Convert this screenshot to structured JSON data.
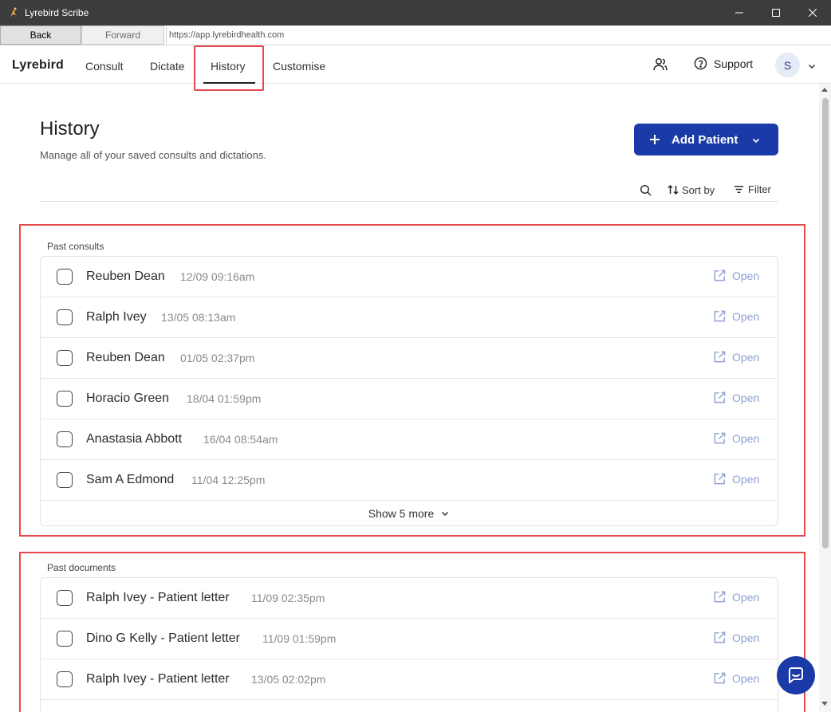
{
  "window": {
    "title": "Lyrebird Scribe",
    "back_label": "Back",
    "forward_label": "Forward",
    "url": "https://app.lyrebirdhealth.com"
  },
  "header": {
    "brand": "Lyrebird",
    "tabs": [
      "Consult",
      "Dictate",
      "History",
      "Customise"
    ],
    "active_tab": "History",
    "support_label": "Support",
    "avatar_initial": "S"
  },
  "page": {
    "title": "History",
    "subtitle": "Manage all of your saved consults and dictations.",
    "add_patient_label": "Add Patient",
    "sort_label": "Sort by",
    "filter_label": "Filter"
  },
  "past_consults": {
    "label": "Past consults",
    "rows": [
      {
        "name": "Reuben Dean",
        "time": "12/09 09:16am",
        "action": "Open"
      },
      {
        "name": "Ralph Ivey",
        "time": "13/05 08:13am",
        "action": "Open"
      },
      {
        "name": "Reuben Dean",
        "time": "01/05 02:37pm",
        "action": "Open"
      },
      {
        "name": "Horacio Green",
        "time": "18/04 01:59pm",
        "action": "Open"
      },
      {
        "name": "Anastasia Abbott",
        "time": "16/04 08:54am",
        "action": "Open"
      },
      {
        "name": "Sam A Edmond",
        "time": "11/04 12:25pm",
        "action": "Open"
      }
    ],
    "show_more_label": "Show 5 more"
  },
  "past_documents": {
    "label": "Past documents",
    "rows": [
      {
        "name": "Ralph Ivey - Patient letter",
        "time": "11/09 02:35pm",
        "action": "Open"
      },
      {
        "name": "Dino G Kelly - Patient letter",
        "time": "11/09 01:59pm",
        "action": "Open"
      },
      {
        "name": "Ralph Ivey - Patient letter",
        "time": "13/05 02:02pm",
        "action": "Open"
      }
    ]
  },
  "colors": {
    "accent": "#1a3aa7",
    "highlight": "#e5484d",
    "open_link": "#8fa0d0"
  }
}
